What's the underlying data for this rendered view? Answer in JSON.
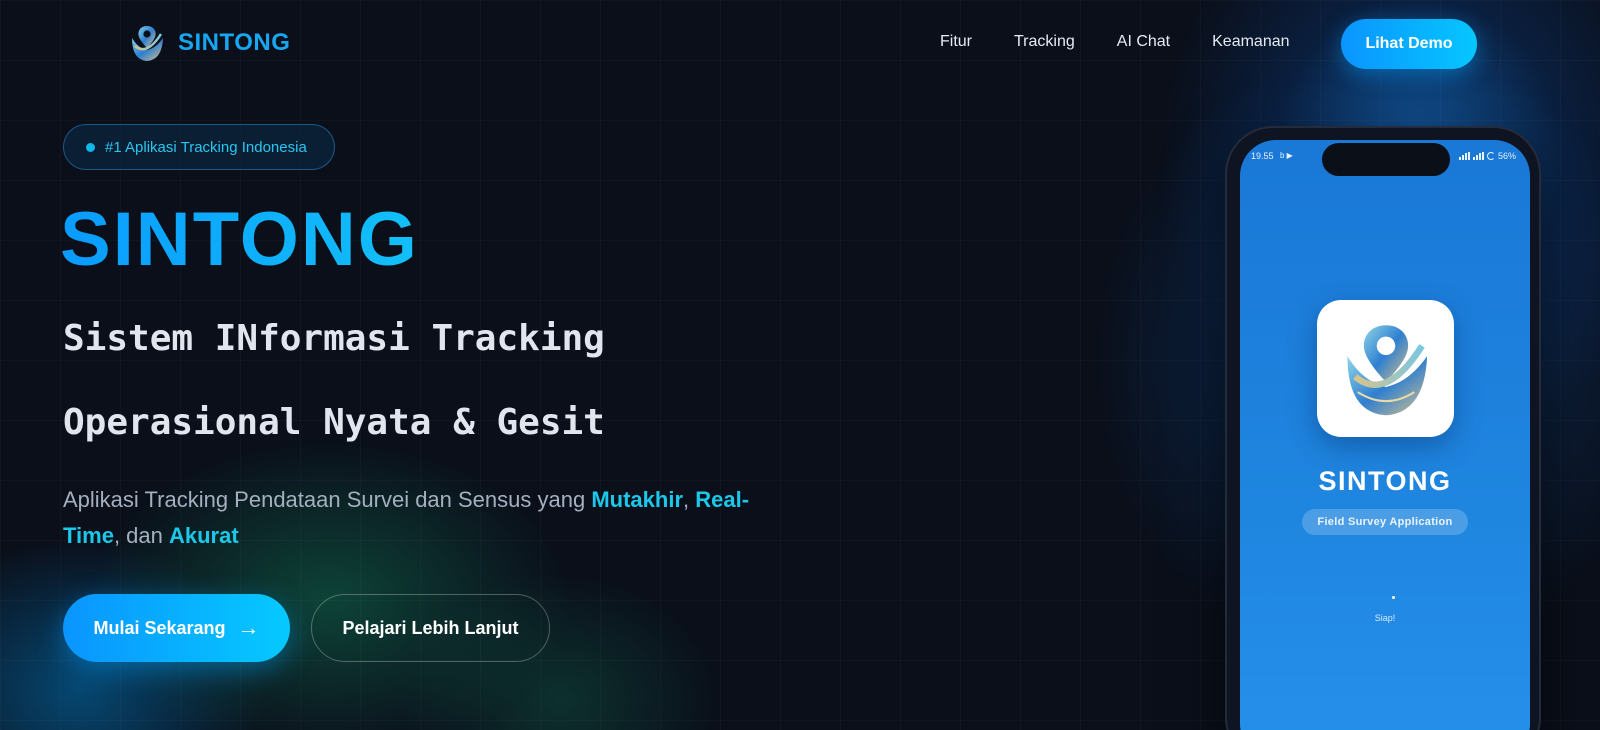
{
  "brand": {
    "name": "SINTONG",
    "logo_icon": "sintong-logo-icon"
  },
  "nav": {
    "links": [
      "Fitur",
      "Tracking",
      "AI Chat",
      "Keamanan"
    ],
    "cta_label": "Lihat Demo"
  },
  "hero": {
    "badge": "#1 Aplikasi Tracking Indonesia",
    "title": "SINTONG",
    "subtitle_line1": "Sistem INformasi Tracking",
    "subtitle_line2": "Operasional Nyata & Gesit",
    "description": {
      "prefix": "Aplikasi Tracking Pendataan Survei dan Sensus yang ",
      "highlight1": "Mutakhir",
      "sep1": ", ",
      "highlight2": "Real-Time",
      "sep2": ", dan ",
      "highlight3": "Akurat"
    },
    "primary_button": "Mulai Sekarang",
    "primary_button_arrow": "→",
    "secondary_button": "Pelajari Lebih Lanjut"
  },
  "phone": {
    "status_time": "19.55",
    "status_battery": "56%",
    "app_name": "SINTONG",
    "app_tagline": "Field Survey Application",
    "loading_text": "Siap!"
  },
  "colors": {
    "accent": "#0a95ff",
    "accent_light": "#06c6ff",
    "highlight": "#1cc8ea",
    "background": "#0a0f1a",
    "phone_screen": "#1f86e0"
  }
}
